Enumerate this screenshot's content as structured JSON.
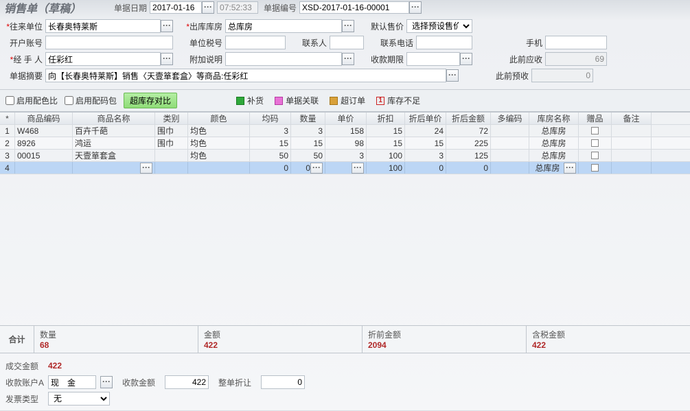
{
  "header": {
    "title": "销售单（草稿）",
    "date_label": "单据日期",
    "date_value": "2017-01-16",
    "time_value": "07:52:33",
    "docno_label": "单据编号",
    "docno_value": "XSD-2017-01-16-00001"
  },
  "form": {
    "customer_label": "往来单位",
    "customer_value": "长春奥特莱斯",
    "warehouse_label": "出库库房",
    "warehouse_value": "总库房",
    "defprice_label": "默认售价",
    "defprice_value": "选择预设售价",
    "bankacct_label": "开户账号",
    "bankacct_value": "",
    "taxno_label": "单位税号",
    "taxno_value": "",
    "contact_label": "联系人",
    "contact_value": "",
    "phone_label": "联系电话",
    "phone_value": "",
    "mobile_label": "手机",
    "mobile_value": "",
    "handler_label": "经 手 人",
    "handler_value": "任彩红",
    "note_label": "附加说明",
    "note_value": "",
    "duedate_label": "收款期限",
    "duedate_value": "",
    "prev_recv_label": "此前应收",
    "prev_recv_value": "69",
    "summary_label": "单据摘要",
    "summary_value": "向【长春奥特莱斯】销售〈天壹箪套盒〉等商品:任彩红",
    "prev_prepay_label": "此前预收",
    "prev_prepay_value": "0"
  },
  "toolbar": {
    "chk_colorratio": "启用配色比",
    "chk_codepack": "启用配码包",
    "btn_overstock": "超库存对比",
    "legend": [
      {
        "color": "#2fa83a",
        "border": "#1a7a22",
        "label": "补货"
      },
      {
        "color": "#e872d6",
        "border": "#b63aa2",
        "label": "单据关联"
      },
      {
        "color": "#d9a13a",
        "border": "#a6761a",
        "label": "超订单"
      },
      {
        "num": "1",
        "label": "库存不足"
      }
    ]
  },
  "grid": {
    "headers": {
      "idx": "*",
      "code": "商品编码",
      "name": "商品名称",
      "cat": "类别",
      "color": "颜色",
      "size": "均码",
      "qty": "数量",
      "price": "单价",
      "disc": "折扣",
      "dprice": "折后单价",
      "damt": "折后金额",
      "mcode": "多编码",
      "wh": "库房名称",
      "gift": "赠品",
      "remark": "备注"
    },
    "rows": [
      {
        "idx": "1",
        "code": "W468",
        "name": "百卉千葩",
        "cat": "围巾",
        "color": "均色",
        "size": "3",
        "qty": "3",
        "price": "158",
        "disc": "15",
        "dprice": "24",
        "damt": "72",
        "mcode": "",
        "wh": "总库房"
      },
      {
        "idx": "2",
        "code": "8926",
        "name": "鸿运",
        "cat": "围巾",
        "color": "均色",
        "size": "15",
        "qty": "15",
        "price": "98",
        "disc": "15",
        "dprice": "15",
        "damt": "225",
        "mcode": "",
        "wh": "总库房"
      },
      {
        "idx": "3",
        "code": "00015",
        "name": "天壹箪套盒",
        "cat": "",
        "color": "均色",
        "size": "50",
        "qty": "50",
        "price": "3",
        "disc": "100",
        "dprice": "3",
        "damt": "125",
        "mcode": "",
        "wh": "总库房"
      },
      {
        "idx": "4",
        "code": "",
        "name": "",
        "cat": "",
        "color": "",
        "size": "0",
        "qty": "0",
        "price": "",
        "disc": "100",
        "dprice": "0",
        "damt": "0",
        "mcode": "",
        "wh": "总库房",
        "selected": true
      }
    ]
  },
  "totals": {
    "label": "合计",
    "cells": [
      {
        "name": "数量",
        "value": "68"
      },
      {
        "name": "金额",
        "value": "422"
      },
      {
        "name": "折前金额",
        "value": "2094"
      },
      {
        "name": "含税金额",
        "value": "422"
      }
    ]
  },
  "footer": {
    "deal_label": "成交金额",
    "deal_value": "422",
    "acctA_label": "收款账户A",
    "acctA_value": "现　金",
    "recv_label": "收款金额",
    "recv_value": "422",
    "wholedisc_label": "整单折让",
    "wholedisc_value": "0",
    "invoice_label": "发票类型",
    "invoice_value": "无"
  }
}
